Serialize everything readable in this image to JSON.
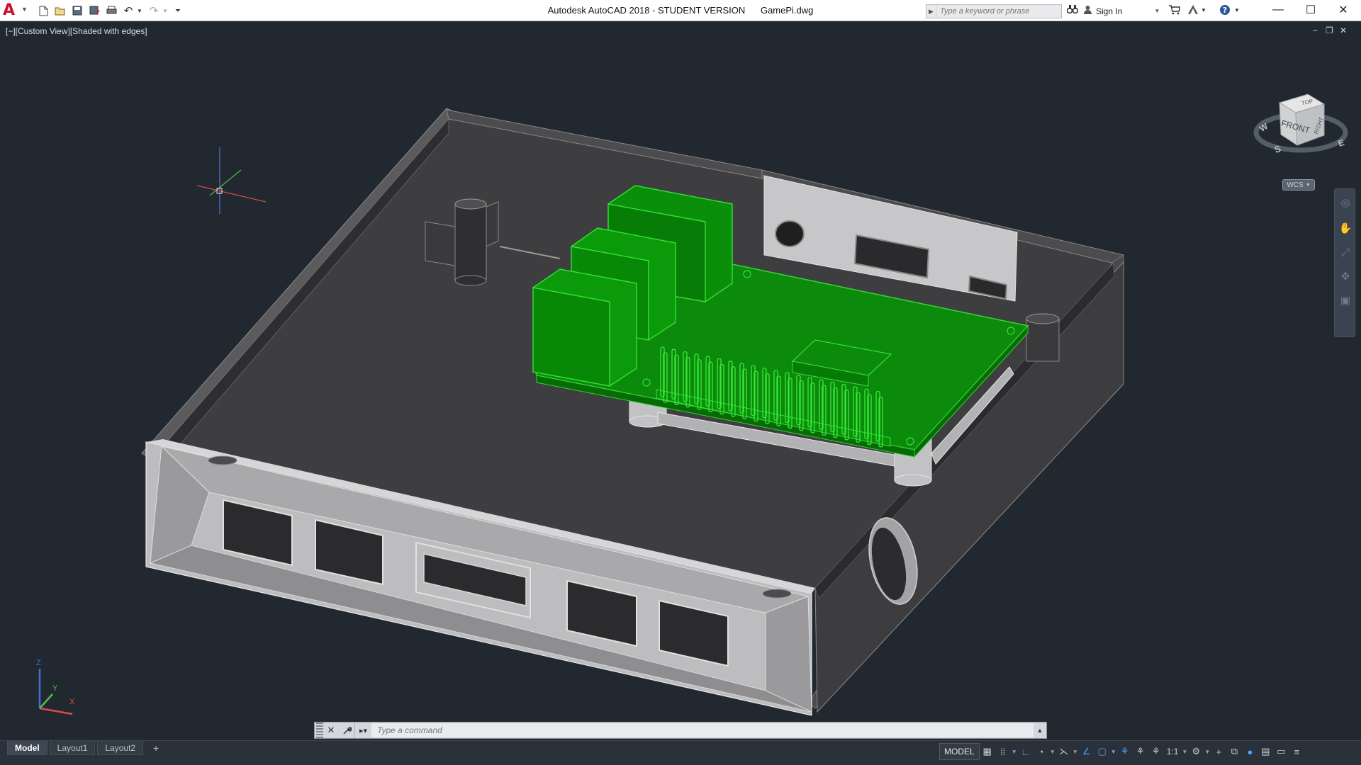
{
  "app": {
    "logo": "A",
    "title": "Autodesk AutoCAD 2018 - STUDENT VERSION",
    "filename": "GamePi.dwg"
  },
  "quick_access": {
    "icons": [
      "new-icon",
      "open-icon",
      "save-icon",
      "save-as-icon",
      "plot-icon",
      "undo-icon",
      "redo-icon",
      "customize-icon"
    ]
  },
  "search": {
    "placeholder": "Type a keyword or phrase"
  },
  "account": {
    "sign_in": "Sign In"
  },
  "window_controls": {
    "minimize": "—",
    "maximize": "☐",
    "close": "✕"
  },
  "viewport": {
    "label": "[−][Custom View][Shaded with edges]",
    "controls": [
      "−",
      "❐",
      "✕"
    ]
  },
  "viewcube": {
    "top": "TOP",
    "front": "FRONT",
    "right": "RIGHT",
    "compass": {
      "west": "W",
      "south": "S",
      "east": "E"
    },
    "wcs": "WCS"
  },
  "ucs": {
    "z": "Z",
    "y": "Y",
    "x": "X"
  },
  "command_line": {
    "placeholder": "Type a command"
  },
  "layout_tabs": [
    {
      "label": "Model",
      "active": true
    },
    {
      "label": "Layout1",
      "active": false
    },
    {
      "label": "Layout2",
      "active": false
    }
  ],
  "status_bar": {
    "model_space": "MODEL",
    "annotation_scale": "1:1"
  },
  "colors": {
    "background": "#212830",
    "pcb_green": "#0a8f0a",
    "case_gray": "#c9c9c9",
    "accent_blue": "#4aa3ff"
  }
}
